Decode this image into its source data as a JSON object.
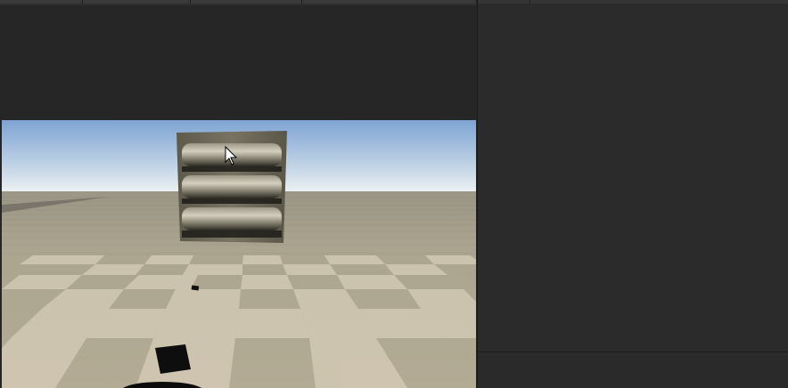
{
  "colors": {
    "sky_top": "#8fb0d8",
    "sky_horizon": "#e9eef2",
    "ground_far": "#8a8676",
    "checker_light": "#c5bca7",
    "checker_dark": "#8e8a77",
    "panel_bg": "#2b2b2b",
    "object_color": "#6b6656"
  },
  "icons": {
    "cursor": "mouse-pointer-icon"
  }
}
